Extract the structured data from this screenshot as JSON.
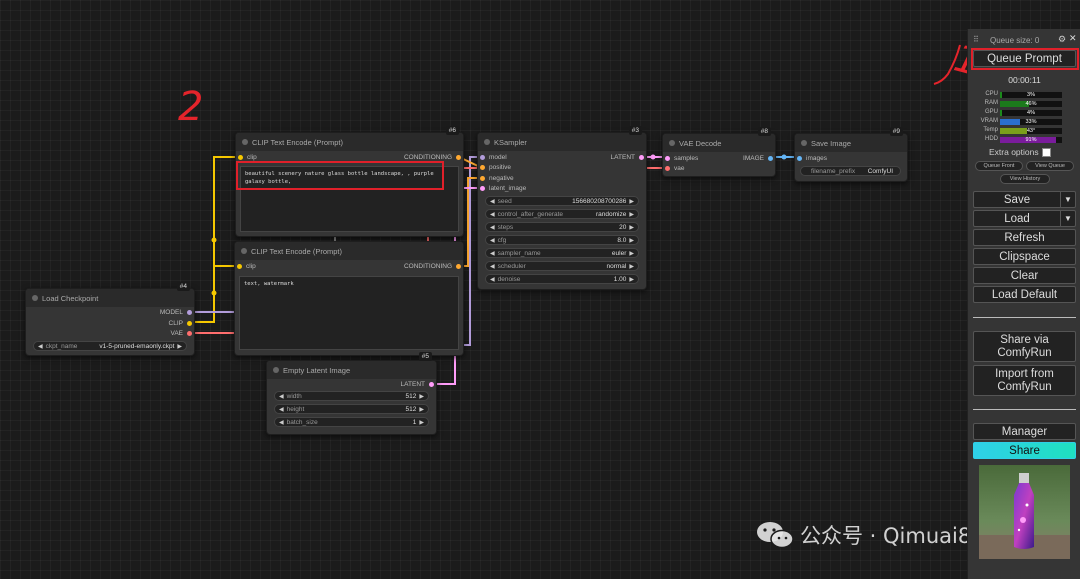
{
  "nodes": {
    "clip_pos": {
      "title": "CLIP Text Encode (Prompt)",
      "id": "#6",
      "input_clip": "clip",
      "output": "CONDITIONING",
      "text": "beautiful scenery nature glass bottle landscape, , purple galaxy bottle,"
    },
    "clip_neg": {
      "title": "CLIP Text Encode (Prompt)",
      "input_clip": "clip",
      "output": "CONDITIONING",
      "text": "text, watermark"
    },
    "ksampler": {
      "title": "KSampler",
      "id": "#3",
      "inputs": [
        "model",
        "positive",
        "negative",
        "latent_image"
      ],
      "output": "LATENT",
      "widgets": [
        {
          "label": "seed",
          "value": "156680208700286"
        },
        {
          "label": "control_after_generate",
          "value": "randomize"
        },
        {
          "label": "steps",
          "value": "20"
        },
        {
          "label": "cfg",
          "value": "8.0"
        },
        {
          "label": "sampler_name",
          "value": "euler"
        },
        {
          "label": "scheduler",
          "value": "normal"
        },
        {
          "label": "denoise",
          "value": "1.00"
        }
      ]
    },
    "vae_decode": {
      "title": "VAE Decode",
      "id": "#8",
      "inputs": [
        "samples",
        "vae"
      ],
      "output": "IMAGE"
    },
    "save_image": {
      "title": "Save Image",
      "id": "#9",
      "input": "images",
      "widget_label": "filename_prefix",
      "widget_value": "ComfyUI"
    },
    "load_checkpoint": {
      "title": "Load Checkpoint",
      "id": "#4",
      "outputs": [
        "MODEL",
        "CLIP",
        "VAE"
      ],
      "widget_label": "ckpt_name",
      "widget_value": "v1-5-pruned-emaonly.ckpt"
    },
    "empty_latent": {
      "title": "Empty Latent Image",
      "id": "#5",
      "output": "LATENT",
      "widgets": [
        {
          "label": "width",
          "value": "512"
        },
        {
          "label": "height",
          "value": "512"
        },
        {
          "label": "batch_size",
          "value": "1"
        }
      ]
    }
  },
  "menu": {
    "queue_size": "Queue size: 0",
    "queue_prompt": "Queue Prompt",
    "timer": "00:00:11",
    "meters": [
      {
        "label": "CPU",
        "value": "3%",
        "fill": 0.03,
        "color": "#1c8a1c"
      },
      {
        "label": "RAM",
        "value": "46%",
        "fill": 0.46,
        "color": "#1c7a1c"
      },
      {
        "label": "GPU",
        "value": "4%",
        "fill": 0.04,
        "color": "#1c8a1c"
      },
      {
        "label": "VRAM",
        "value": "33%",
        "fill": 0.33,
        "color": "#2a6fcf"
      },
      {
        "label": "Temp",
        "value": "43°",
        "fill": 0.43,
        "color": "#7aa01c"
      },
      {
        "label": "HDD",
        "value": "91%",
        "fill": 0.91,
        "color": "#7a1c9c"
      }
    ],
    "extra_options": "Extra options",
    "queue_front": "Queue Front",
    "view_queue": "View Queue",
    "view_history": "View History",
    "save": "Save",
    "load": "Load",
    "refresh": "Refresh",
    "clipspace": "Clipspace",
    "clear": "Clear",
    "load_default": "Load Default",
    "share_via_1": "Share via",
    "share_via_2": "ComfyRun",
    "import_from_1": "Import from",
    "import_from_2": "ComfyRun",
    "manager": "Manager",
    "share": "Share"
  },
  "annotations": {
    "one": "1",
    "two": "2"
  },
  "watermark": "公众号 · Qimuai8",
  "colors": {
    "clip": "#f6c800",
    "model": "#b39ddb",
    "vae": "#ff6e6e",
    "conditioning": "#ffa931",
    "latent": "#ff9cf9",
    "image": "#64b5f6",
    "accent_red": "#e0202a"
  }
}
